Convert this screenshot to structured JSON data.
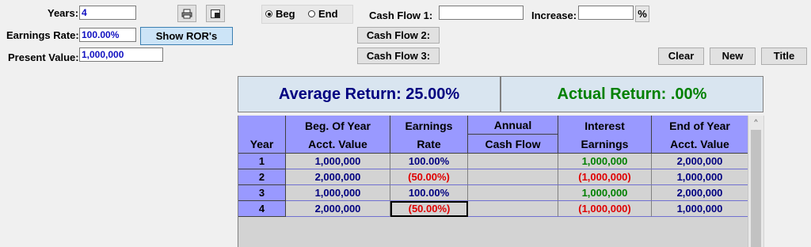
{
  "inputs": {
    "years_label": "Years:",
    "years_value": "4",
    "earnings_rate_label": "Earnings Rate:",
    "earnings_rate_value": "100.00%",
    "present_value_label": "Present Value:",
    "present_value_value": "1,000,000",
    "show_ror_label": "Show ROR's"
  },
  "icons": {
    "print": "print-icon",
    "export": "export-icon"
  },
  "timing": {
    "beg_label": "Beg",
    "end_label": "End",
    "selected": "Beg"
  },
  "cashflow": {
    "cf1_label": "Cash Flow 1:",
    "cf1_value": "",
    "cf2_label": "Cash Flow 2:",
    "cf3_label": "Cash Flow 3:",
    "increase_label": "Increase:",
    "increase_value": "",
    "pct_label": "%"
  },
  "actions": {
    "clear": "Clear",
    "new": "New",
    "title": "Title"
  },
  "summary": {
    "average": "Average Return: 25.00%",
    "actual": "Actual Return: .00%"
  },
  "table": {
    "headers": {
      "year": "Year",
      "beg_l1": "Beg. Of Year",
      "beg_l2": "Acct. Value",
      "rate_l1": "Earnings",
      "rate_l2": "Rate",
      "cf_l1": "Annual",
      "cf_l2": "Cash Flow",
      "int_l1": "Interest",
      "int_l2": "Earnings",
      "end_l1": "End of Year",
      "end_l2": "Acct. Value"
    },
    "rows": [
      {
        "year": "1",
        "beg": "1,000,000",
        "rate": "100.00%",
        "cf": "",
        "interest": "1,000,000",
        "end": "2,000,000"
      },
      {
        "year": "2",
        "beg": "2,000,000",
        "rate": "(50.00%)",
        "cf": "",
        "interest": "(1,000,000)",
        "end": "1,000,000"
      },
      {
        "year": "3",
        "beg": "1,000,000",
        "rate": "100.00%",
        "cf": "",
        "interest": "1,000,000",
        "end": "2,000,000"
      },
      {
        "year": "4",
        "beg": "2,000,000",
        "rate": "(50.00%)",
        "cf": "",
        "interest": "(1,000,000)",
        "end": "1,000,000"
      }
    ]
  },
  "colors": {
    "header_bg": "#9999ff",
    "summary_bg": "#d9e5f0",
    "average_text": "#000080",
    "actual_text": "#008000",
    "negative_text": "#e00000",
    "positive_interest_text": "#008000"
  }
}
